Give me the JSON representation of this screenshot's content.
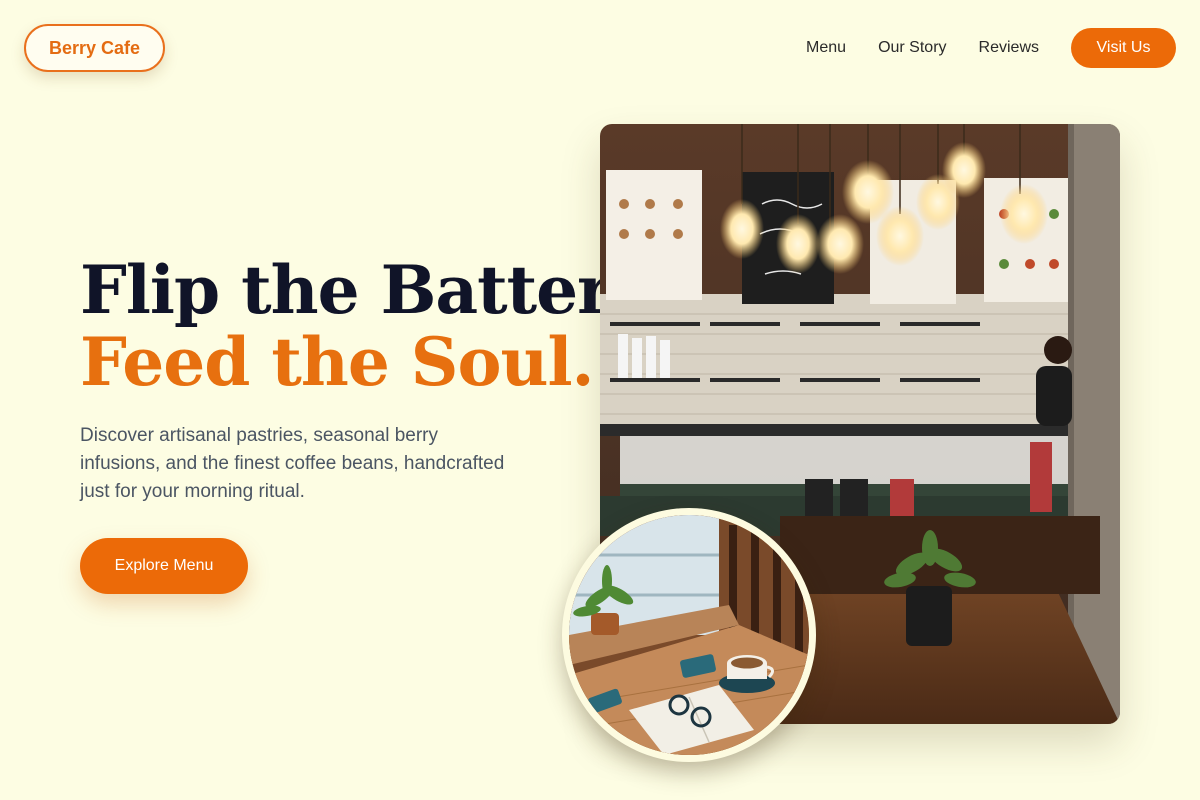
{
  "brand": {
    "name": "Berry Cafe",
    "accent": "#ec6a08"
  },
  "nav": {
    "links": [
      "Menu",
      "Our Story",
      "Reviews"
    ],
    "cta_label": "Visit Us"
  },
  "hero": {
    "headline_line1": "Flip the Batter,",
    "headline_line2": "Feed the Soul.",
    "description": "Discover artisanal pastries, seasonal berry infusions, and the finest coffee beans, handcrafted just for your morning ritual.",
    "cta_label": "Explore Menu"
  },
  "images": {
    "main_photo": "cafe-interior-photo",
    "inset_photo": "coffee-table-photo"
  }
}
